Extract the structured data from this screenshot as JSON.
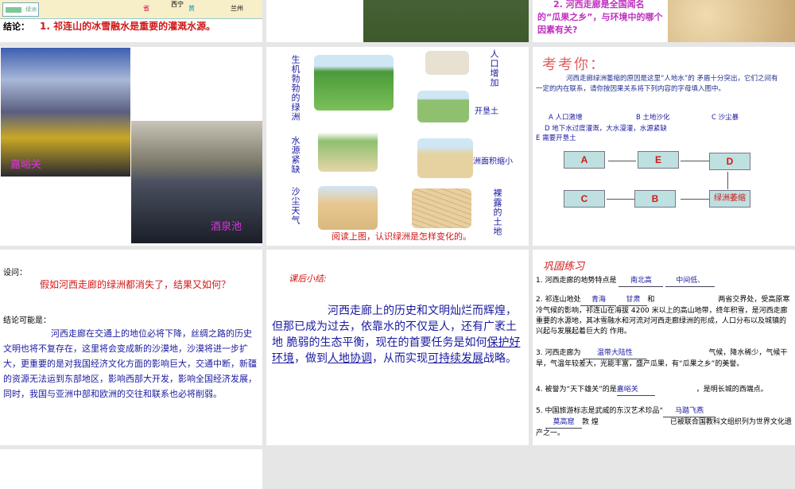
{
  "slide1": {
    "map_legend": "绿洲",
    "map_labels": [
      "西宁",
      "省",
      "黄",
      "兰州"
    ],
    "conclusion_label": "结论：",
    "conclusion_text": "1.  祁连山的冰雪融水是重要的灌溉水源。"
  },
  "slide3": {
    "question": "2. 河西走廊是全国闻名的“瓜果之乡”，与环境中的哪个因素有关?"
  },
  "slide4": {
    "label1": "嘉峪关",
    "label2": "酒泉池"
  },
  "slide5": {
    "left_labels": [
      "生机勃勃的绿洲",
      "水源紧缺",
      "沙尘天气"
    ],
    "right_labels": [
      "人口增加",
      "开垦土",
      "绿洲面积缩小",
      "裸露的土地"
    ],
    "caption": "阅读上图，认识绿洲是怎样变化的。"
  },
  "slide6": {
    "title": "考考你：",
    "intro": "河西走廊绿洲萎缩的原因是这里“人地水”的 矛盾十分突出，它们之间有一定的内在联系，请你按因果关系将下列内容的字母填入图中。",
    "opt_a": "A  人口激增",
    "opt_b": "B 土地沙化",
    "opt_c": "C 沙尘暴",
    "opt_d": "D 地下水过度灌溉，大水漫灌，水源紧缺",
    "opt_e": "E 需要开垦土",
    "boxes": {
      "a": "A",
      "e": "E",
      "d": "D",
      "c": "C",
      "b": "B",
      "oasis": "绿洲萎缩"
    }
  },
  "slide7": {
    "q_label": "设问：",
    "question": "假如河西走廊的绿洲都消失了，结果又如何？",
    "c_label": "结论可能是：",
    "conclusion": "河西走廊在交通上的地位必将下降，丝绸之路的历史文明也将不复存在，这里将会变成新的沙漠地，沙漠将进一步扩大，更重要的是对我国经济文化方面的影响巨大，交通中断，新疆的资源无法运到东部地区，影响西部大开发，影响全国经济发展，同时，我国与亚洲中部和欧洲的交往和联系也必将削弱。"
  },
  "slide8": {
    "title": "课后小结:",
    "p1": "河西走廊上的历史和文明灿烂而辉煌，但那已成为过去，依靠水的不仅是人，还有广袤土地 脆弱的生态平衡，现在的首要任务是如何",
    "u1": "保护好环境",
    "p2": "，做到",
    "u2": "人地协调",
    "p3": "，从而实现",
    "u3": "可持续发展",
    "p4": "战略。"
  },
  "slide9": {
    "title": "巩固练习",
    "q1": "1. 河西走廊的地势特点是",
    "a1a": "南北高",
    "a1b": "中间低、",
    "q2a": "2. 祁连山地处",
    "a2a": "青海",
    "a2b": "甘肃",
    "q2b": "和",
    "q2c": "两省交界处，受高原寒冷气候的影响，祁连山在海拔 4200 米以上的高山地带，终年积雪，是河西走廊重要的水源地，其冰雪融水和河流对河西走廊绿洲的形成，人口分布以及城镇的兴起与发展起着巨大的 作用。",
    "q3a": "3. 河西走廊为",
    "a3": "温带大陆性",
    "q3b": "气候，降水稀少，气候干旱，气温年较差大，光能丰富，盛产瓜果，有“瓜果之乡”的美誉。",
    "q4a": "4. 被誉为“天下雄关”的是",
    "a4": "嘉峪关",
    "q4b": "，是明长城的西端点。",
    "q5a": "5. 中国旅游标志是武威的东汉艺术珍品“",
    "a5a": "马踏飞燕",
    "a5b": "莫高窟",
    "q5b": "敦 煌",
    "q5c": "已被联合国教科文组织列为世界文化遗产之一。"
  }
}
